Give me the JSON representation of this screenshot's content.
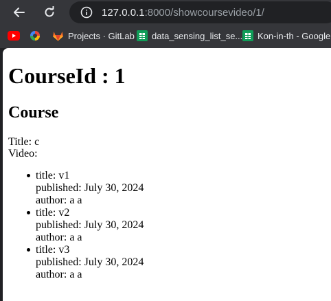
{
  "browser": {
    "url_host": "127.0.0.1",
    "url_rest": ":8000/showcoursevideo/1/",
    "bookmarks": [
      {
        "label": "",
        "icon": "youtube-icon"
      },
      {
        "label": "",
        "icon": "colorful-site-icon"
      },
      {
        "label": "Projects · GitLab",
        "icon": "gitlab-icon"
      },
      {
        "label": "data_sensing_list_se...",
        "icon": "google-sheets-icon"
      },
      {
        "label": "Kon-in-th - Google...",
        "icon": "google-sheets-icon"
      }
    ]
  },
  "page": {
    "heading": "CourseId : 1",
    "subheading": "Course",
    "title_line": "Title: c",
    "video_label": "Video:",
    "videos": [
      {
        "title": "title: v1",
        "published": "published: July 30, 2024",
        "author": "author: a a"
      },
      {
        "title": "title: v2",
        "published": "published: July 30, 2024",
        "author": "author: a a"
      },
      {
        "title": "title: v3",
        "published": "published: July 30, 2024",
        "author": "author: a a"
      }
    ]
  }
}
